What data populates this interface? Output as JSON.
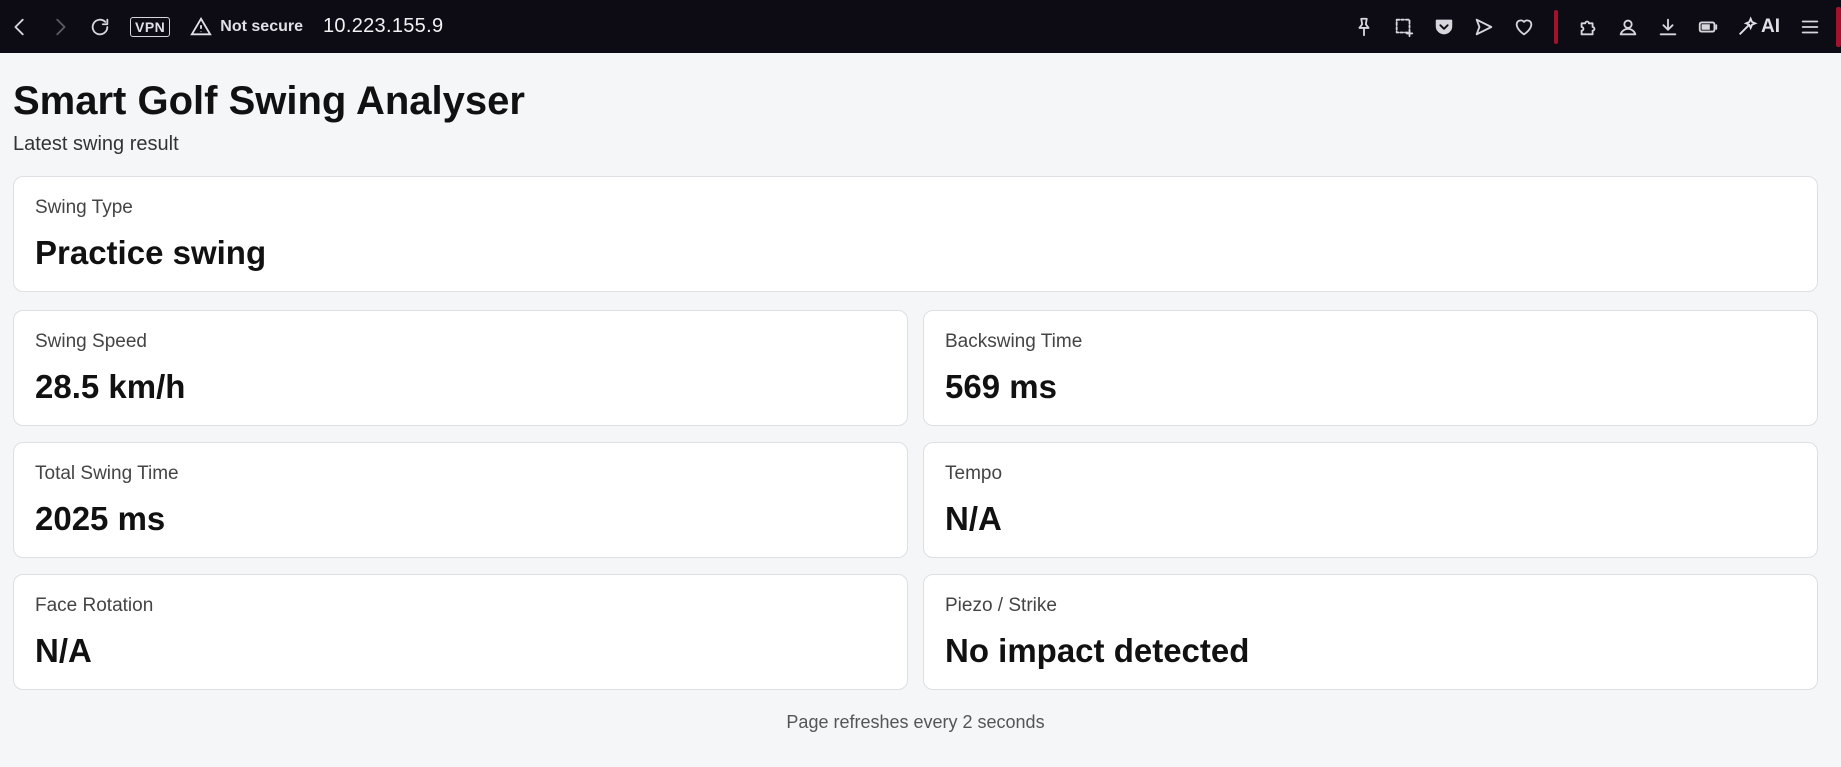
{
  "browser": {
    "vpn_label": "VPN",
    "security_label": "Not secure",
    "url": "10.223.155.9",
    "ai_label": "AI"
  },
  "page": {
    "title": "Smart Golf Swing Analyser",
    "subtitle": "Latest swing result",
    "footer": "Page refreshes every 2 seconds"
  },
  "swing_type": {
    "label": "Swing Type",
    "value": "Practice swing"
  },
  "metrics": [
    {
      "label": "Swing Speed",
      "value": "28.5 km/h"
    },
    {
      "label": "Backswing Time",
      "value": "569 ms"
    },
    {
      "label": "Total Swing Time",
      "value": "2025 ms"
    },
    {
      "label": "Tempo",
      "value": "N/A"
    },
    {
      "label": "Face Rotation",
      "value": "N/A"
    },
    {
      "label": "Piezo / Strike",
      "value": "No impact detected"
    }
  ]
}
